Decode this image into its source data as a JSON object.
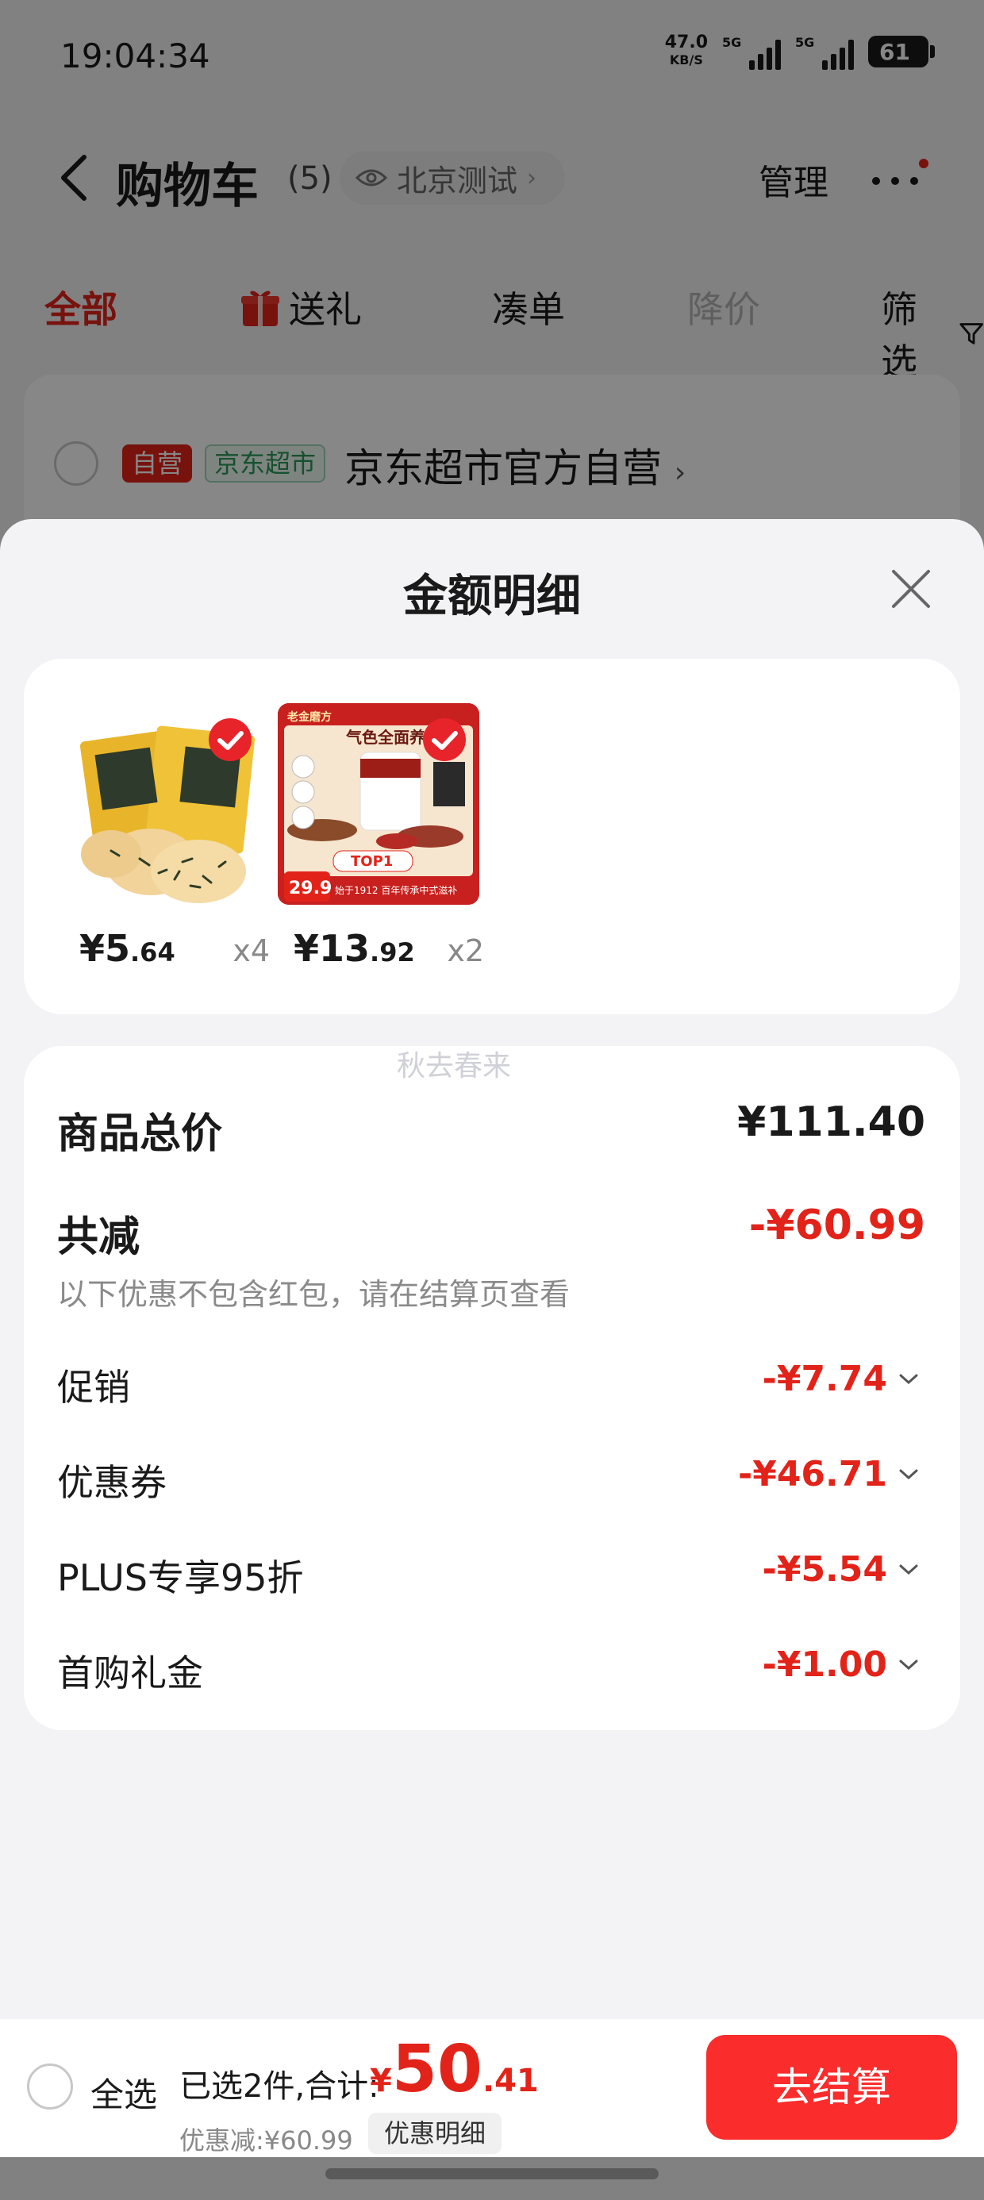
{
  "status_bar": {
    "time": "19:04:34",
    "net_speed": "47.0",
    "net_unit": "KB/S",
    "sim1": "5G",
    "sim2": "5G",
    "battery": "61"
  },
  "header": {
    "title": "购物车",
    "count": "(5)",
    "location": "北京测试",
    "manage": "管理"
  },
  "filter_tabs": {
    "all": "全部",
    "gift": "送礼",
    "together": "凑单",
    "price_drop": "降价",
    "filter": "筛选"
  },
  "store": {
    "self_badge": "自营",
    "supermarket_badge": "京东超市",
    "name": "京东超市官方自营"
  },
  "sheet": {
    "title": "金额明细",
    "watermark": "秋去春来",
    "products": [
      {
        "price_int": "¥5",
        "price_dec": ".64",
        "qty": "x4"
      },
      {
        "price_int": "¥13",
        "price_dec": ".92",
        "qty": "x2",
        "img_text": {
          "brand": "老金磨方",
          "headline": "气色全面养",
          "rank": "TOP1",
          "promo_price": "29.9",
          "slogan": "始于1912 百年传承中式滋补"
        }
      }
    ],
    "total_label": "商品总价",
    "total_value": "¥111.40",
    "reduce_label": "共减",
    "reduce_value": "-¥60.99",
    "reduce_note": "以下优惠不包含红包，请在结算页查看",
    "items": [
      {
        "label": "促销",
        "value": "-¥7.74"
      },
      {
        "label": "优惠券",
        "value": "-¥46.71"
      },
      {
        "label": "PLUS专享95折",
        "value": "-¥5.54"
      },
      {
        "label": "首购礼金",
        "value": "-¥1.00"
      }
    ]
  },
  "checkout": {
    "select_all": "全选",
    "selected_summary": "已选2件,合计:",
    "total_symbol": "¥",
    "total_int": "50",
    "total_dec": ".41",
    "discount_text": "优惠减:¥60.99",
    "detail_button": "优惠明细",
    "checkout_button": "去结算"
  },
  "colors": {
    "accent_red": "#e2231a",
    "checkout_red": "#fa2c2c",
    "check_red": "#e8242b"
  }
}
